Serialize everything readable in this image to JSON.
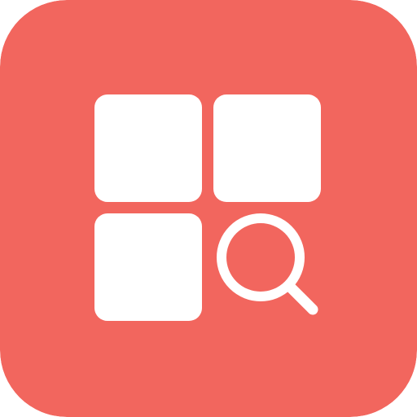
{
  "app_icon": {
    "icon": "grid-with-search-icon",
    "background_color": "#F2665E",
    "foreground_color": "#FFFFFF",
    "tiles": [
      {
        "icon": "grid-tile-top-left"
      },
      {
        "icon": "grid-tile-top-right"
      },
      {
        "icon": "grid-tile-bottom-left"
      }
    ],
    "search": {
      "icon": "magnifier-icon"
    }
  }
}
